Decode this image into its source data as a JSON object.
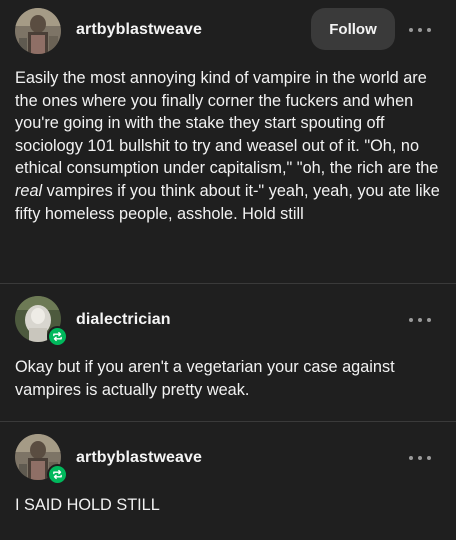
{
  "posts": [
    {
      "username": "artbyblastweave",
      "follow_label": "Follow",
      "has_follow": true,
      "body_parts": [
        "Easily the most annoying kind of vampire in the world are the ones where you finally corner the fuckers and when you're going in with the stake they start spouting off sociology 101 bullshit to try and weasel out of it. \"Oh, no ethical consumption under capitalism,\" \"oh, the rich are the ",
        "real",
        " vampires if you think about it-\" yeah, yeah,  you ate like fifty homeless people, asshole. Hold still"
      ]
    },
    {
      "username": "dialectrician",
      "has_follow": false,
      "reblog_icon": "reblog-icon",
      "body": "Okay but if you aren't a vegetarian your case against vampires is actually pretty weak."
    },
    {
      "username": "artbyblastweave",
      "has_follow": false,
      "reblog_icon": "reblog-icon",
      "body": "I SAID HOLD STILL"
    }
  ],
  "icons": {
    "more": "more-options-icon",
    "reblog": "reblog-icon"
  },
  "colors": {
    "background": "#1f1f1f",
    "divider": "#3a3a3a",
    "follow_button": "#3a3a3a",
    "reblog_badge": "#00b85c",
    "text": "#f2f2f2"
  }
}
